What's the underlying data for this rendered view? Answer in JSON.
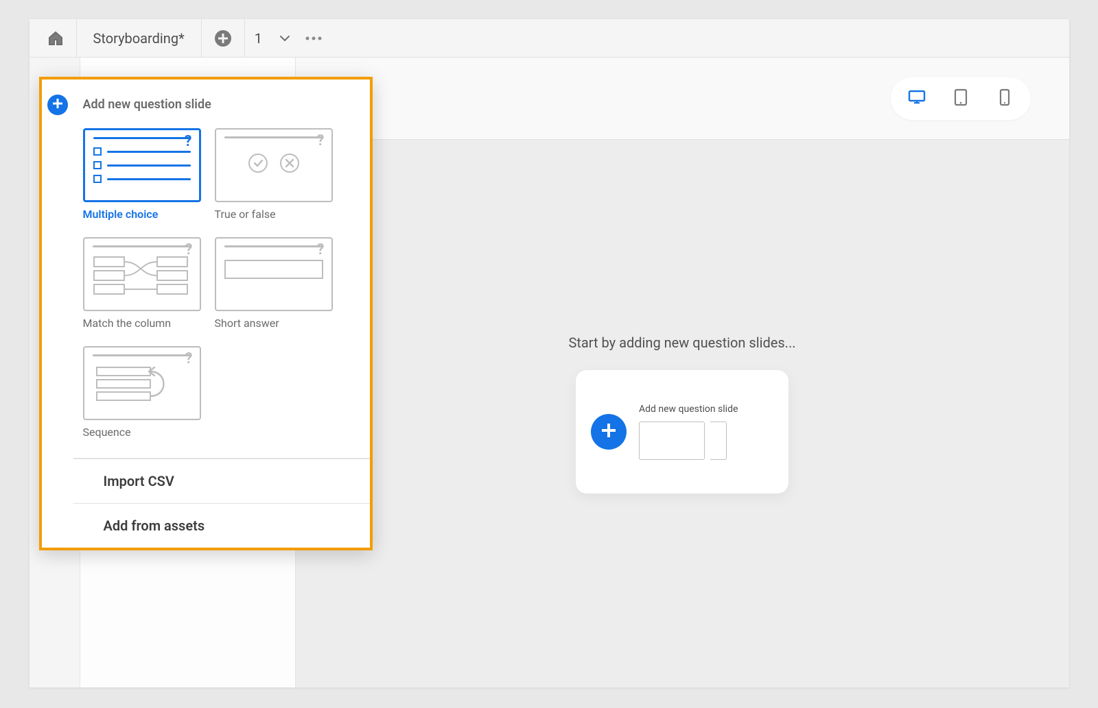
{
  "topbar": {
    "title": "Storyboarding*",
    "page_number": "1"
  },
  "device_switch": {
    "active": "desktop"
  },
  "canvas": {
    "empty_message": "Start by adding new question slides...",
    "mini_panel_title": "Add new question slide"
  },
  "popover": {
    "title": "Add new question slide",
    "options": [
      {
        "label": "Multiple choice",
        "selected": true,
        "kind": "mc"
      },
      {
        "label": "True or false",
        "selected": false,
        "kind": "tf"
      },
      {
        "label": "Match the column",
        "selected": false,
        "kind": "match"
      },
      {
        "label": "Short answer",
        "selected": false,
        "kind": "short"
      },
      {
        "label": "Sequence",
        "selected": false,
        "kind": "seq"
      }
    ],
    "actions": {
      "import_csv": "Import CSV",
      "add_from_assets": "Add from assets"
    }
  }
}
